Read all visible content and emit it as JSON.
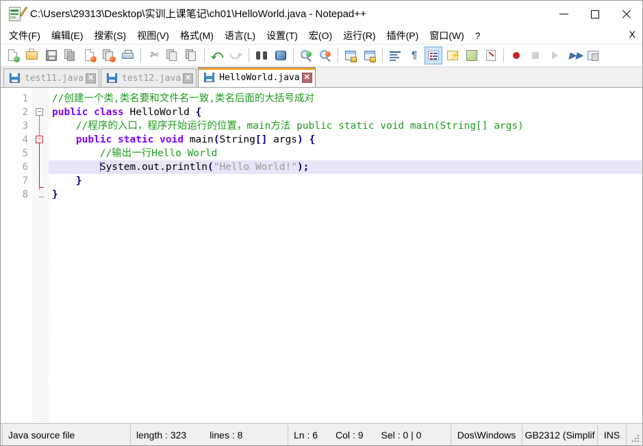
{
  "window": {
    "title": "C:\\Users\\29313\\Desktop\\实训上课笔记\\ch01\\HelloWorld.java - Notepad++",
    "app_icon": "notepad-plus-plus-icon",
    "controls": {
      "minimize": "—",
      "maximize": "□",
      "close": "✕"
    }
  },
  "menubar": {
    "items": [
      {
        "label": "文件(F)",
        "name": "menu-file"
      },
      {
        "label": "编辑(E)",
        "name": "menu-edit"
      },
      {
        "label": "搜索(S)",
        "name": "menu-search"
      },
      {
        "label": "视图(V)",
        "name": "menu-view"
      },
      {
        "label": "格式(M)",
        "name": "menu-format"
      },
      {
        "label": "语言(L)",
        "name": "menu-language"
      },
      {
        "label": "设置(T)",
        "name": "menu-settings"
      },
      {
        "label": "宏(O)",
        "name": "menu-macro"
      },
      {
        "label": "运行(R)",
        "name": "menu-run"
      },
      {
        "label": "插件(P)",
        "name": "menu-plugins"
      },
      {
        "label": "窗口(W)",
        "name": "menu-window"
      },
      {
        "label": "?",
        "name": "menu-help"
      }
    ],
    "close_document": "X"
  },
  "toolbar": {
    "buttons": [
      "new-file-icon",
      "open-file-icon",
      "save-icon",
      "save-all-icon",
      "close-file-icon",
      "close-all-files-icon",
      "print-icon",
      "cut-icon",
      "copy-icon",
      "paste-icon",
      "undo-icon",
      "redo-icon",
      "find-icon",
      "replace-icon",
      "zoom-in-icon",
      "zoom-out-icon",
      "sync-vertical-scroll-icon",
      "sync-horizontal-scroll-icon",
      "word-wrap-icon",
      "show-all-characters-icon",
      "show-indent-guide-icon",
      "user-defined-language-icon",
      "document-map-icon",
      "function-list-icon",
      "start-recording-icon",
      "stop-recording-icon",
      "play-macro-icon",
      "run-macro-multiple-icon",
      "run-icon"
    ]
  },
  "tabs": [
    {
      "label": "test11.java",
      "active": false,
      "icon": "save-blue-icon",
      "close": "✕"
    },
    {
      "label": "test12.java",
      "active": false,
      "icon": "save-blue-icon",
      "close": "✕"
    },
    {
      "label": "HelloWorld.java",
      "active": true,
      "icon": "save-blue-icon",
      "close": "✕"
    }
  ],
  "editor": {
    "line_numbers": [
      "1",
      "2",
      "3",
      "4",
      "5",
      "6",
      "7",
      "8"
    ],
    "current_line": 6,
    "lines": [
      {
        "n": 1,
        "tokens": [
          {
            "t": "//创建一个类,类名要和文件名一致,类名后面的大括号成对",
            "c": "cm"
          }
        ]
      },
      {
        "n": 2,
        "tokens": [
          {
            "t": "public",
            "c": "k"
          },
          {
            "t": " ",
            "c": "id"
          },
          {
            "t": "class",
            "c": "k"
          },
          {
            "t": " HelloWorld ",
            "c": "id"
          },
          {
            "t": "{",
            "c": "op"
          }
        ]
      },
      {
        "n": 3,
        "tokens": [
          {
            "t": "    //程序的入口，程序开始运行的位置，main方法 public static void main(String[] args)",
            "c": "cm"
          }
        ]
      },
      {
        "n": 4,
        "tokens": [
          {
            "t": "    ",
            "c": "id"
          },
          {
            "t": "public",
            "c": "k"
          },
          {
            "t": " ",
            "c": "id"
          },
          {
            "t": "static",
            "c": "k"
          },
          {
            "t": " ",
            "c": "id"
          },
          {
            "t": "void",
            "c": "k"
          },
          {
            "t": " main",
            "c": "id"
          },
          {
            "t": "(",
            "c": "op"
          },
          {
            "t": "String",
            "c": "id"
          },
          {
            "t": "[]",
            "c": "op"
          },
          {
            "t": " args",
            "c": "id"
          },
          {
            "t": ")",
            "c": "op"
          },
          {
            "t": " ",
            "c": "id"
          },
          {
            "t": "{",
            "c": "op"
          }
        ]
      },
      {
        "n": 5,
        "tokens": [
          {
            "t": "        //输出一行Hello World",
            "c": "cm"
          }
        ]
      },
      {
        "n": 6,
        "tokens": [
          {
            "t": "        ",
            "c": "id"
          },
          {
            "t": "CARET",
            "c": "caret"
          },
          {
            "t": "System.out.println",
            "c": "id"
          },
          {
            "t": "(",
            "c": "op"
          },
          {
            "t": "\"Hello World!\"",
            "c": "st"
          },
          {
            "t": ")",
            "c": "op"
          },
          {
            "t": ";",
            "c": "op"
          }
        ]
      },
      {
        "n": 7,
        "tokens": [
          {
            "t": "    ",
            "c": "id"
          },
          {
            "t": "}",
            "c": "op"
          }
        ]
      },
      {
        "n": 8,
        "tokens": [
          {
            "t": "}",
            "c": "op"
          }
        ]
      }
    ]
  },
  "statusbar": {
    "doc_type": "Java source file",
    "length_label": "length : 323",
    "lines_label": "lines : 8",
    "ln": "Ln : 6",
    "col": "Col : 9",
    "sel": "Sel : 0 | 0",
    "eol": "Dos\\Windows",
    "encoding": "GB2312 (Simplif",
    "insert_mode": "INS"
  },
  "colors": {
    "active_tab_accent": "#f3a332",
    "keyword": "#8000ff",
    "comment": "#1f9a1f",
    "operator": "#000080",
    "string": "#9a9a9a",
    "current_line_bg": "#e5e6f7",
    "linenumber": "#a0a0a0"
  }
}
